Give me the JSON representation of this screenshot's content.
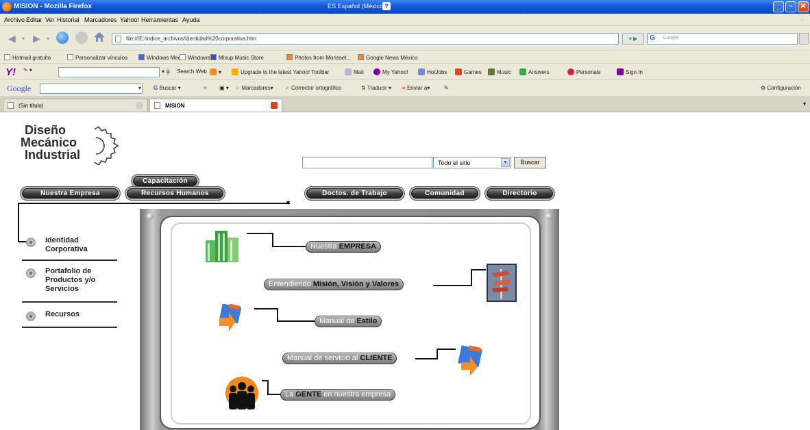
{
  "window": {
    "title": "MISION - Mozilla Firefox",
    "language_indicator": "ES Español (México)",
    "language_help": "?"
  },
  "menu": [
    "Archivo",
    "Editar",
    "Ver",
    "Historial",
    "Marcadores",
    "Yahoo!",
    "Herramientas",
    "Ayuda"
  ],
  "address": {
    "url": "file:///E:/indice_archivos/identidad%20corporativa.htm",
    "search_placeholder": "Google"
  },
  "bookmarks": [
    "Hotmail gratuito",
    "Personalizar vínculos",
    "Windows Media",
    "Windows",
    "Mixup Music Store",
    "Photos from Morisset...",
    "Google News México"
  ],
  "yahoo_toolbar": {
    "logo": "Y!",
    "search_label": "Search Web",
    "items": [
      "Upgrade to the latest Yahoo! Toolbar",
      "Mail",
      "My Yahoo!",
      "HotJobs",
      "Games",
      "Music",
      "Answers",
      "Personals",
      "Sign In"
    ]
  },
  "google_toolbar": {
    "logo": "Google",
    "items": [
      "Buscar",
      "Marcadores",
      "Corrector ortográfico",
      "Traducir",
      "Enviar a"
    ],
    "settings": "Configuración"
  },
  "tabs": [
    {
      "label": "(Sin título)"
    },
    {
      "label": "MISION"
    }
  ],
  "logo": {
    "line1": "Diseño",
    "line2": "Mecánico",
    "line3": "Industrial"
  },
  "site_search": {
    "scope": "Todo el sitio",
    "button": "Buscar"
  },
  "nav": {
    "nuestra_empresa": "Nuestra Empresa",
    "capacitacion": "Capacitación",
    "recursos_humanos": "Recursos Humanos",
    "doctos": "Doctos. de Trabajo",
    "comunidad": "Comunidad",
    "directorio": "Directorio"
  },
  "sidebar": [
    {
      "label": "Identidad Corporativa"
    },
    {
      "label": "Portafolio de Productos y/o Servicios"
    },
    {
      "label": "Recursos"
    }
  ],
  "links": {
    "empresa_pre": "Nuestra ",
    "empresa_bold": "EMPRESA",
    "mision_pre": "Entendiendo ",
    "mision_bold": "Misión, Visión y Valores",
    "estilo_pre": "Manual de ",
    "estilo_bold": "Estilo",
    "cliente_pre": "Manual de servicio al ",
    "cliente_bold": "CLIENTE",
    "gente_pre": "La ",
    "gente_bold": "GENTE",
    "gente_post": " en nuestra empresa"
  },
  "colors": {
    "titlebar": "#1457d6",
    "chrome": "#ece9d8",
    "pill_dark": "#3a3a3a",
    "green_building": "#4caf50",
    "orange_arrow": "#e8862a",
    "blue_book": "#3b7ad9"
  }
}
